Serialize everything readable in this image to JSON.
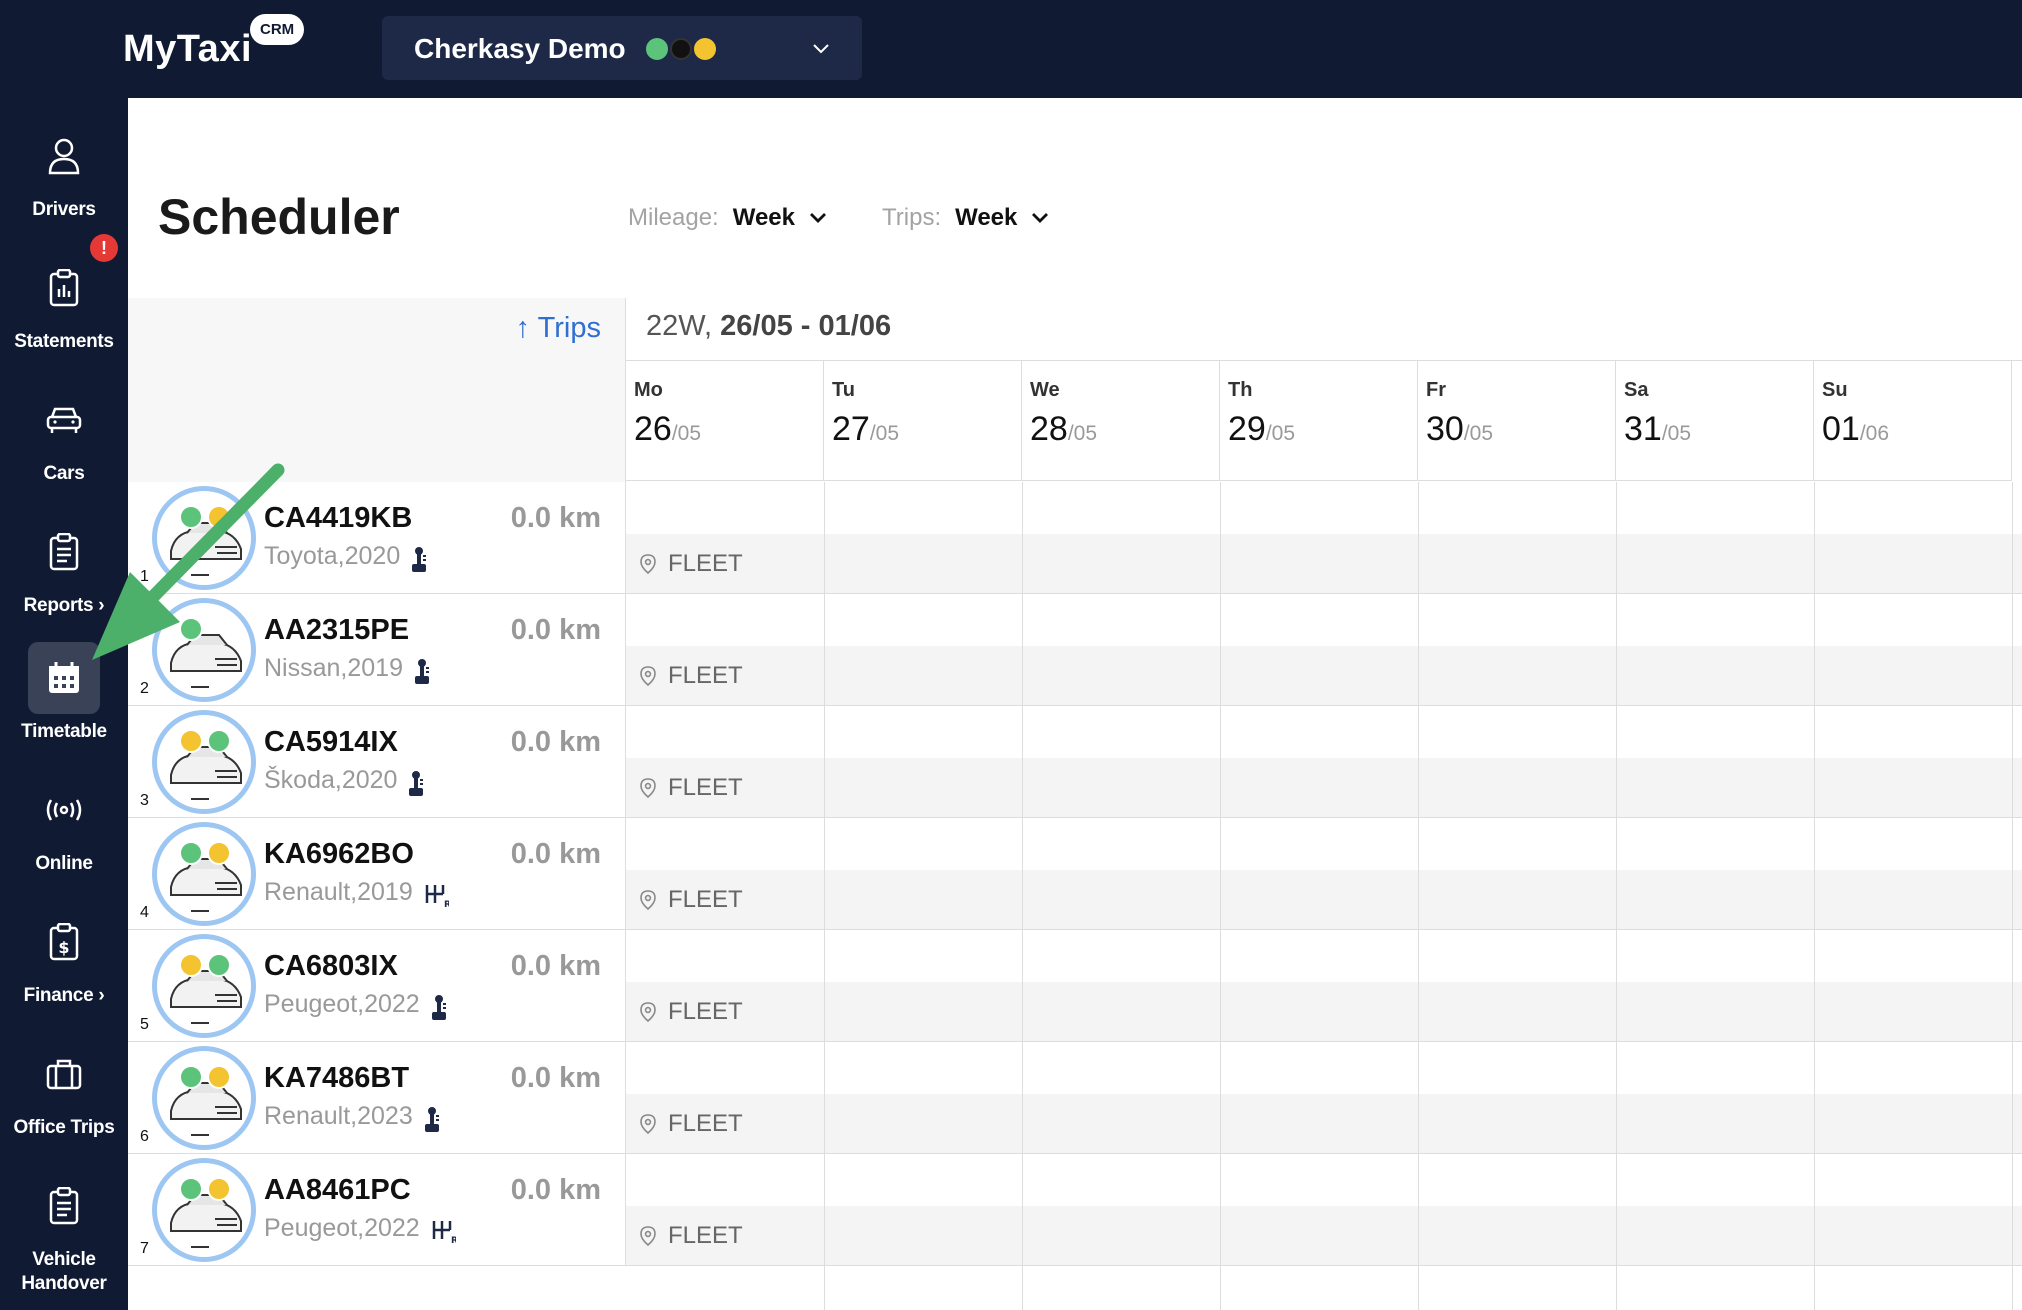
{
  "app": {
    "name": "MyTaxi",
    "badge": "CRM"
  },
  "company": {
    "name": "Cherkasy Demo",
    "service_colors": [
      "#5cc47a",
      "#111111",
      "#f4c430"
    ]
  },
  "sidebar": {
    "items": [
      {
        "label": "Drivers",
        "icon": "person-icon"
      },
      {
        "label": "Statements",
        "icon": "clipboard-chart-icon",
        "alert": "!"
      },
      {
        "label": "Cars",
        "icon": "car-icon"
      },
      {
        "label": "Reports ›",
        "icon": "report-icon"
      },
      {
        "label": "Timetable",
        "icon": "calendar-icon",
        "active": true
      },
      {
        "label": "Online",
        "icon": "broadcast-icon"
      },
      {
        "label": "Finance ›",
        "icon": "finance-icon"
      },
      {
        "label": "Office Trips",
        "icon": "briefcase-icon"
      },
      {
        "label": "Vehicle Handover",
        "icon": "handover-clipboard-icon"
      }
    ]
  },
  "page": {
    "title": "Scheduler",
    "mileage_label": "Mileage:",
    "mileage_value": "Week",
    "trips_label": "Trips:",
    "trips_value": "Week",
    "sort_link": "↑ Trips",
    "week_prefix": "22W,",
    "week_range": "26/05 - 01/06"
  },
  "days": [
    {
      "name": "Mo",
      "num": "26",
      "month": "/05"
    },
    {
      "name": "Tu",
      "num": "27",
      "month": "/05"
    },
    {
      "name": "We",
      "num": "28",
      "month": "/05"
    },
    {
      "name": "Th",
      "num": "29",
      "month": "/05"
    },
    {
      "name": "Fr",
      "num": "30",
      "month": "/05"
    },
    {
      "name": "Sa",
      "num": "31",
      "month": "/05"
    },
    {
      "name": "Su",
      "num": "01",
      "month": "/06"
    }
  ],
  "cars": [
    {
      "index": "1",
      "plate": "CA4419KB",
      "model": "Toyota,2020",
      "km": "0.0 km",
      "gear": "automatic",
      "location": "FLEET"
    },
    {
      "index": "2",
      "plate": "AA2315PE",
      "model": "Nissan,2019",
      "km": "0.0 km",
      "gear": "automatic",
      "location": "FLEET"
    },
    {
      "index": "3",
      "plate": "CA5914IX",
      "model": "Škoda,2020",
      "km": "0.0 km",
      "gear": "automatic",
      "location": "FLEET"
    },
    {
      "index": "4",
      "plate": "KA6962BO",
      "model": "Renault,2019",
      "km": "0.0 km",
      "gear": "manual",
      "location": "FLEET"
    },
    {
      "index": "5",
      "plate": "CA6803IX",
      "model": "Peugeot,2022",
      "km": "0.0 km",
      "gear": "automatic",
      "location": "FLEET"
    },
    {
      "index": "6",
      "plate": "KA7486BT",
      "model": "Renault,2023",
      "km": "0.0 km",
      "gear": "automatic",
      "location": "FLEET"
    },
    {
      "index": "7",
      "plate": "AA8461PC",
      "model": "Peugeot,2022",
      "km": "0.0 km",
      "gear": "manual",
      "location": "FLEET"
    }
  ],
  "annotation": {
    "arrow_color": "#4caf6a",
    "arrow_target": "Timetable"
  }
}
